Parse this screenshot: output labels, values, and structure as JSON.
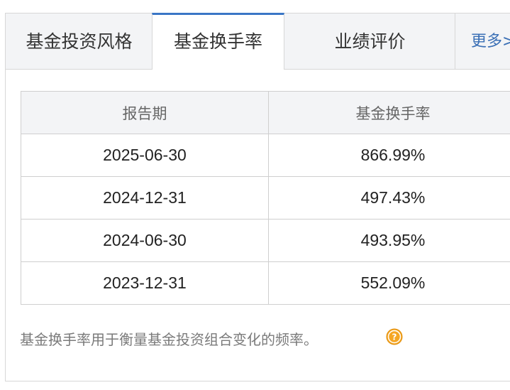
{
  "tabs": [
    {
      "label": "基金投资风格",
      "active": false
    },
    {
      "label": "基金换手率",
      "active": true
    },
    {
      "label": "业绩评价",
      "active": false
    }
  ],
  "more_label": "更多>",
  "table": {
    "headers": [
      "报告期",
      "基金换手率"
    ],
    "rows": [
      {
        "period": "2025-06-30",
        "rate": "866.99%"
      },
      {
        "period": "2024-12-31",
        "rate": "497.43%"
      },
      {
        "period": "2024-06-30",
        "rate": "493.95%"
      },
      {
        "period": "2023-12-31",
        "rate": "552.09%"
      }
    ]
  },
  "note": "基金换手率用于衡量基金投资组合变化的频率。",
  "icons": {
    "help": "question-circle-icon"
  },
  "colors": {
    "accent": "#3a76c6",
    "help_icon": "#f5a623",
    "tab_bg": "#f3f4f6"
  }
}
